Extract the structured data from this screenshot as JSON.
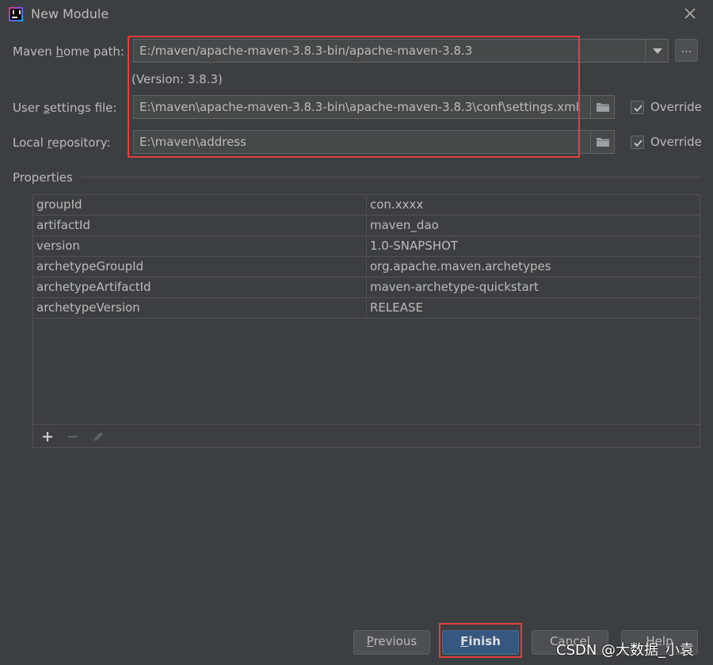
{
  "window": {
    "title": "New Module"
  },
  "maven_home": {
    "label_pre": "Maven ",
    "label_mnemonic": "h",
    "label_post": "ome path:",
    "value": "E:/maven/apache-maven-3.8.3-bin/apache-maven-3.8.3",
    "browse_label": "...",
    "version_text": "(Version: 3.8.3)"
  },
  "user_settings": {
    "label_pre": "User ",
    "label_mnemonic": "s",
    "label_post": "ettings file:",
    "value": "E:\\maven\\apache-maven-3.8.3-bin\\apache-maven-3.8.3\\conf\\settings.xml",
    "override_label": "Override",
    "override_checked": true
  },
  "local_repo": {
    "label_pre": "Local ",
    "label_mnemonic": "r",
    "label_post": "epository:",
    "value": "E:\\maven\\address",
    "override_label": "Override",
    "override_checked": true
  },
  "properties": {
    "title": "Properties",
    "rows": [
      {
        "key": "groupId",
        "value": "con.xxxx"
      },
      {
        "key": "artifactId",
        "value": "maven_dao"
      },
      {
        "key": "version",
        "value": "1.0-SNAPSHOT"
      },
      {
        "key": "archetypeGroupId",
        "value": "org.apache.maven.archetypes"
      },
      {
        "key": "archetypeArtifactId",
        "value": "maven-archetype-quickstart"
      },
      {
        "key": "archetypeVersion",
        "value": "RELEASE"
      }
    ]
  },
  "buttons": {
    "previous_mnemonic": "P",
    "previous_rest": "revious",
    "finish_mnemonic": "F",
    "finish_rest": "inish",
    "cancel": "Cancel",
    "help": "Help"
  },
  "watermark": "CSDN @大数据_小袁",
  "colors": {
    "background": "#3c3f41",
    "field_background": "#45494a",
    "finish_button": "#365880",
    "highlight_box": "#e0403f"
  }
}
